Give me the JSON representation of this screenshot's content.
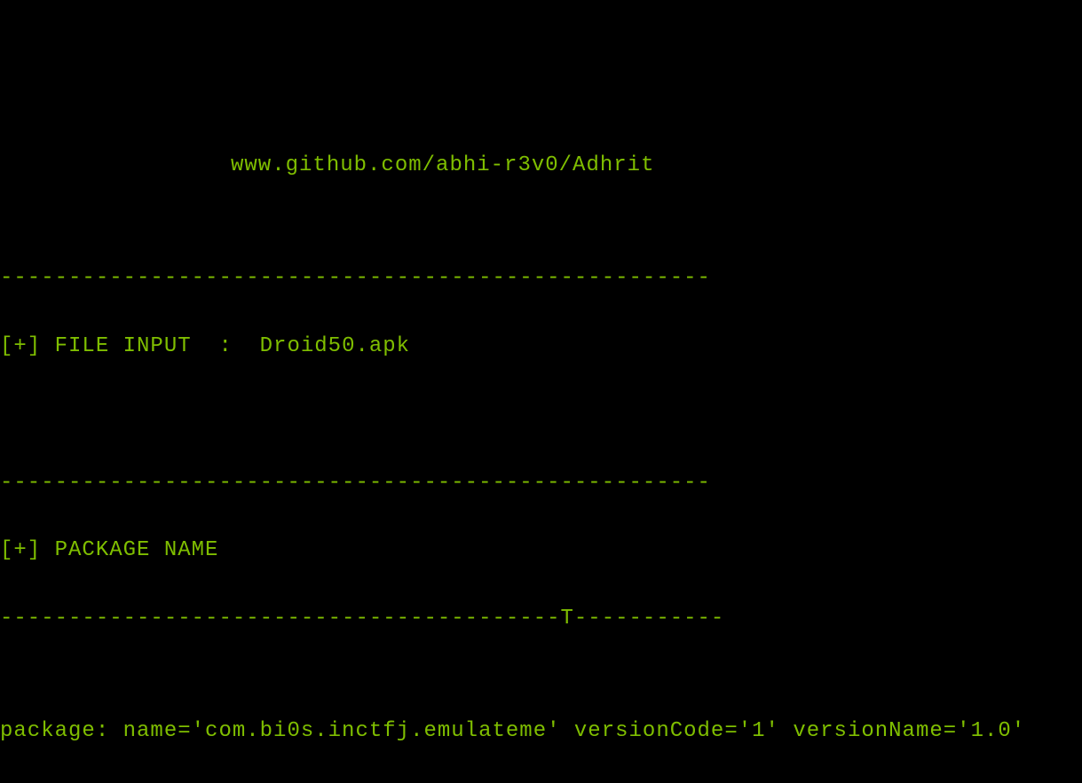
{
  "header": {
    "url": "www.github.com/abhi-r3v0/Adhrit"
  },
  "divider": "----------------------------------------------------",
  "file_input": {
    "label": "[+] FILE INPUT  :  ",
    "value": "Droid50.apk"
  },
  "package_name_section": {
    "label": "[+] PACKAGE NAME"
  },
  "divider_with_cursor": "-----------------------------------------T-----------",
  "package_info": {
    "line": "package: name='com.bi0s.inctfj.emulateme' versionCode='1' versionName='1.0'"
  }
}
